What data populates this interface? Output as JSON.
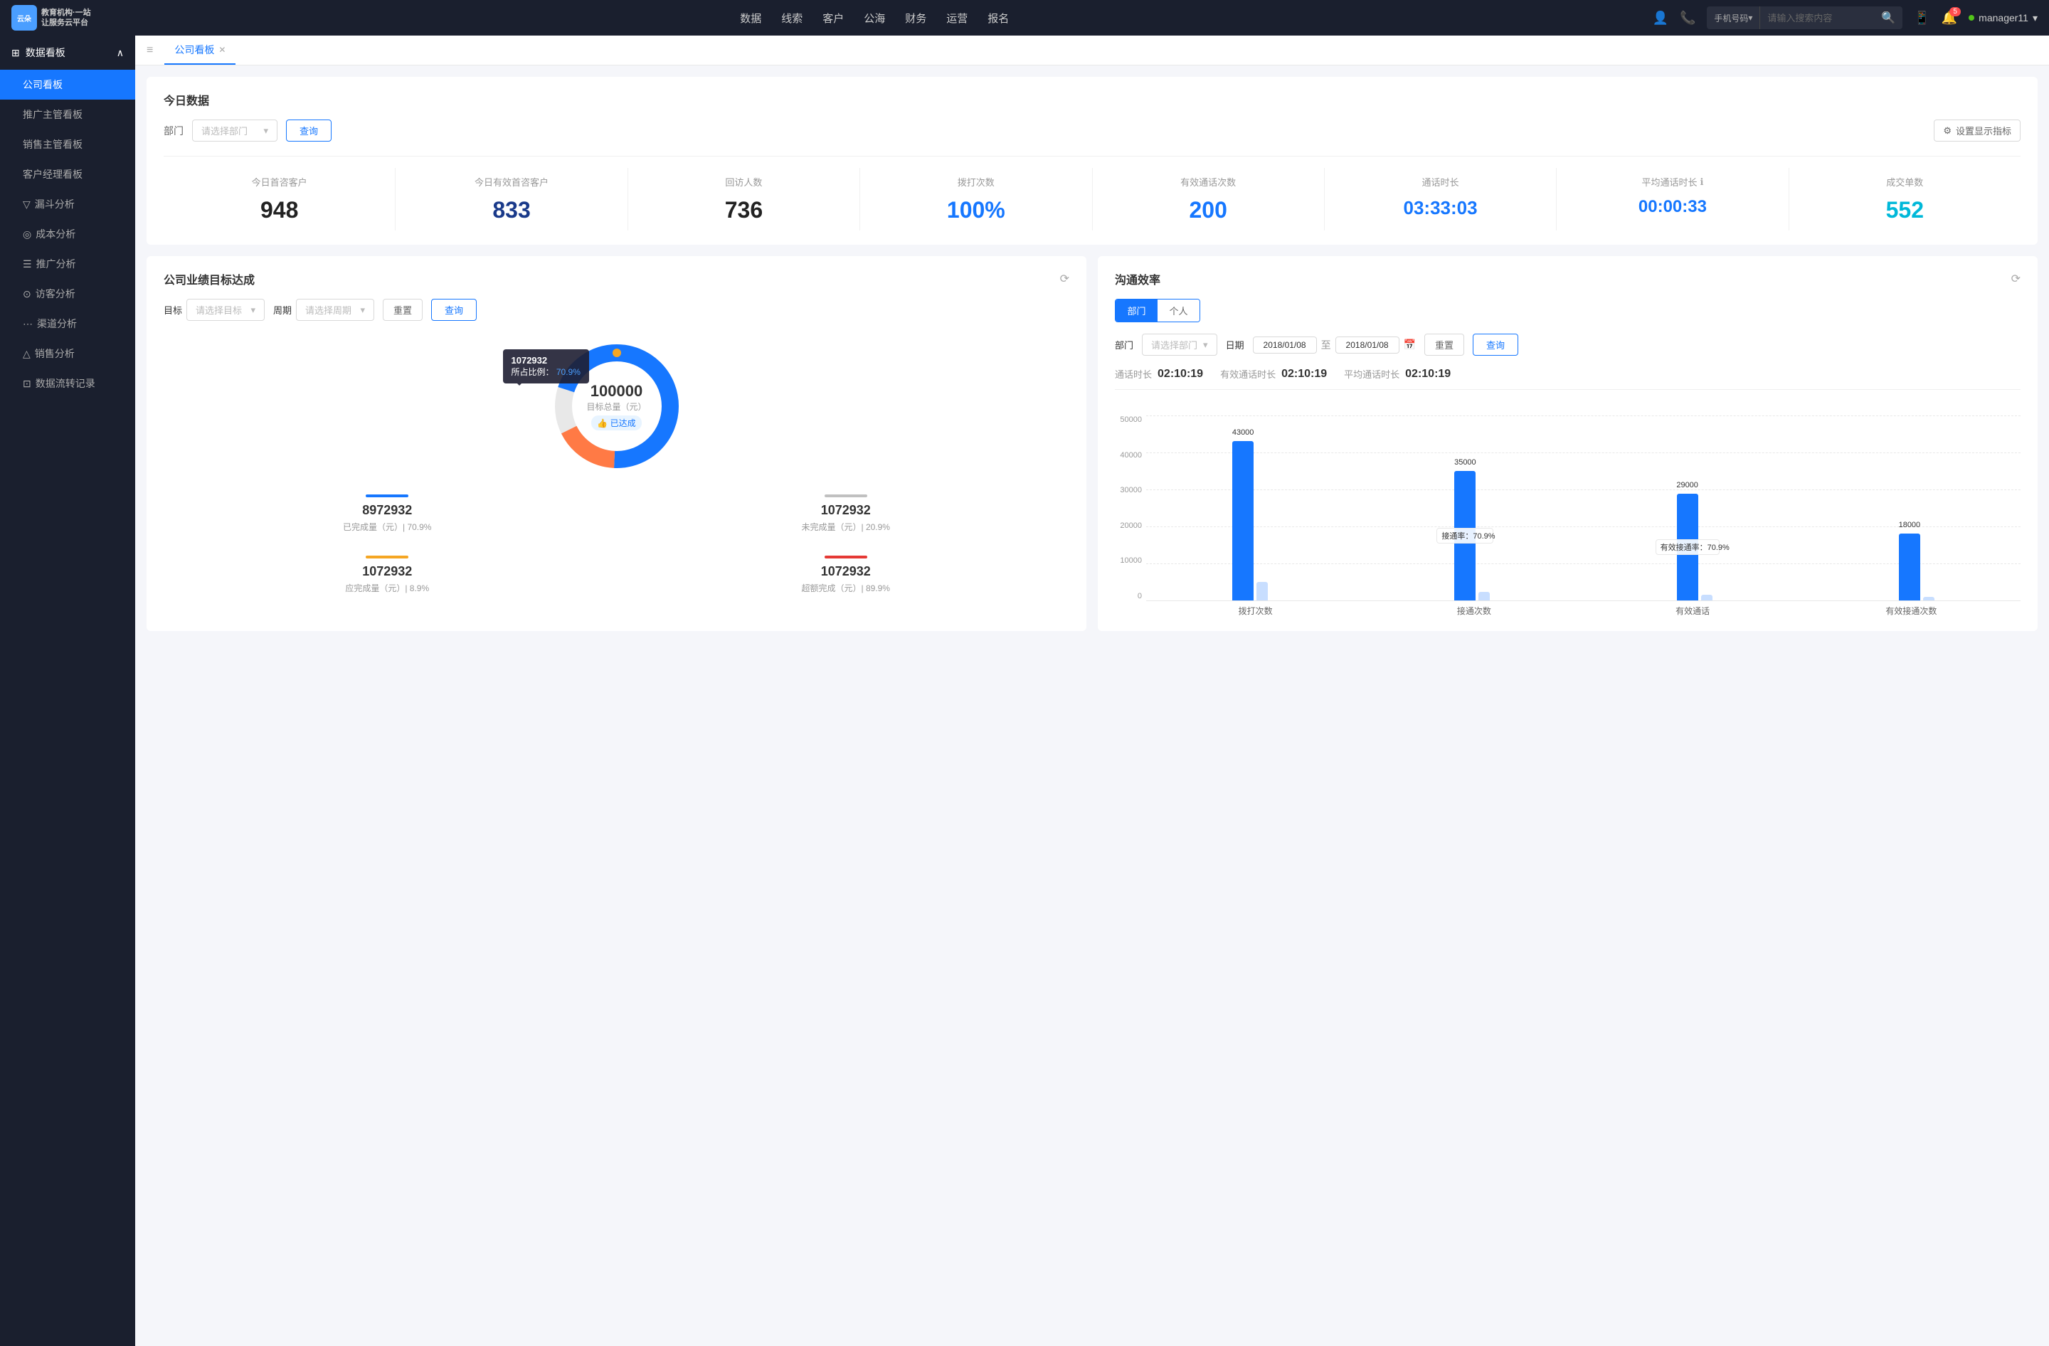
{
  "app": {
    "logo_line1": "云朵CRM",
    "logo_line2": "教育机构·一站",
    "logo_line3": "让服务云平台"
  },
  "nav": {
    "items": [
      "数据",
      "线索",
      "客户",
      "公海",
      "财务",
      "运营",
      "报名"
    ],
    "search": {
      "type": "手机号码",
      "placeholder": "请输入搜索内容"
    },
    "user": "manager11",
    "bell_count": "5"
  },
  "sidebar": {
    "section": "数据看板",
    "items": [
      {
        "label": "公司看板",
        "active": true
      },
      {
        "label": "推广主管看板",
        "active": false
      },
      {
        "label": "销售主管看板",
        "active": false
      },
      {
        "label": "客户经理看板",
        "active": false
      },
      {
        "label": "漏斗分析",
        "active": false
      },
      {
        "label": "成本分析",
        "active": false
      },
      {
        "label": "推广分析",
        "active": false
      },
      {
        "label": "访客分析",
        "active": false
      },
      {
        "label": "渠道分析",
        "active": false
      },
      {
        "label": "销售分析",
        "active": false
      },
      {
        "label": "数据流转记录",
        "active": false
      }
    ]
  },
  "tab": {
    "label": "公司看板"
  },
  "today": {
    "title": "今日数据",
    "dept_label": "部门",
    "dept_placeholder": "请选择部门",
    "query_btn": "查询",
    "settings_btn": "设置显示指标",
    "stats": [
      {
        "label": "今日首咨客户",
        "value": "948",
        "color": "dark"
      },
      {
        "label": "今日有效首咨客户",
        "value": "833",
        "color": "dark-blue"
      },
      {
        "label": "回访人数",
        "value": "736",
        "color": "dark"
      },
      {
        "label": "拨打次数",
        "value": "100%",
        "color": "blue"
      },
      {
        "label": "有效通话次数",
        "value": "200",
        "color": "blue"
      },
      {
        "label": "通话时长",
        "value": "03:33:03",
        "color": "blue"
      },
      {
        "label": "平均通话时长",
        "value": "00:00:33",
        "color": "blue"
      },
      {
        "label": "成交单数",
        "value": "552",
        "color": "cyan"
      }
    ]
  },
  "business_target": {
    "title": "公司业绩目标达成",
    "target_label": "目标",
    "target_placeholder": "请选择目标",
    "period_label": "周期",
    "period_placeholder": "请选择周期",
    "reset_btn": "重置",
    "query_btn": "查询",
    "tooltip_num": "1072932",
    "tooltip_pct_label": "所占比例：",
    "tooltip_pct": "70.9%",
    "donut_center_num": "100000",
    "donut_center_label": "目标总量（元）",
    "donut_center_badge": "👍 已达成",
    "stats": [
      {
        "bar_color": "#1677ff",
        "num": "8972932",
        "desc": "已完成量（元）| 70.9%"
      },
      {
        "bar_color": "#c0c0c0",
        "num": "1072932",
        "desc": "未完成量（元）| 20.9%"
      },
      {
        "bar_color": "#f5a623",
        "num": "1072932",
        "desc": "应完成量（元）| 8.9%"
      },
      {
        "bar_color": "#e53935",
        "num": "1072932",
        "desc": "超额完成（元）| 89.9%"
      }
    ]
  },
  "comm_efficiency": {
    "title": "沟通效率",
    "dept_tab": "部门",
    "person_tab": "个人",
    "dept_label": "部门",
    "dept_placeholder": "请选择部门",
    "date_label": "日期",
    "date_from": "2018/01/08",
    "date_to": "2018/01/08",
    "reset_btn": "重置",
    "query_btn": "查询",
    "call_duration_label": "通话时长",
    "call_duration_value": "02:10:19",
    "effective_duration_label": "有效通话时长",
    "effective_duration_value": "02:10:19",
    "avg_duration_label": "平均通话时长",
    "avg_duration_value": "02:10:19",
    "chart": {
      "y_labels": [
        "50000",
        "40000",
        "30000",
        "20000",
        "10000",
        "0"
      ],
      "groups": [
        {
          "x_label": "拨打次数",
          "bars": [
            {
              "value": 43000,
              "label": "43000",
              "color": "blue",
              "height_pct": 86
            },
            {
              "value": null,
              "label": "",
              "color": "light",
              "height_pct": 12
            }
          ]
        },
        {
          "x_label": "接通次数",
          "bars": [
            {
              "value": 35000,
              "label": "35000",
              "color": "blue",
              "height_pct": 70
            },
            {
              "value": null,
              "label": "",
              "color": "light",
              "height_pct": 5
            }
          ],
          "inner_label": "接通率：70.9%"
        },
        {
          "x_label": "有效通话",
          "bars": [
            {
              "value": 29000,
              "label": "29000",
              "color": "blue",
              "height_pct": 58
            },
            {
              "value": null,
              "label": "",
              "color": "light",
              "height_pct": 3
            }
          ],
          "inner_label": "有效接通率：70.9%"
        },
        {
          "x_label": "有效接通次数",
          "bars": [
            {
              "value": 18000,
              "label": "18000",
              "color": "blue",
              "height_pct": 36
            },
            {
              "value": null,
              "label": "",
              "color": "light",
              "height_pct": 2
            }
          ]
        }
      ]
    }
  }
}
